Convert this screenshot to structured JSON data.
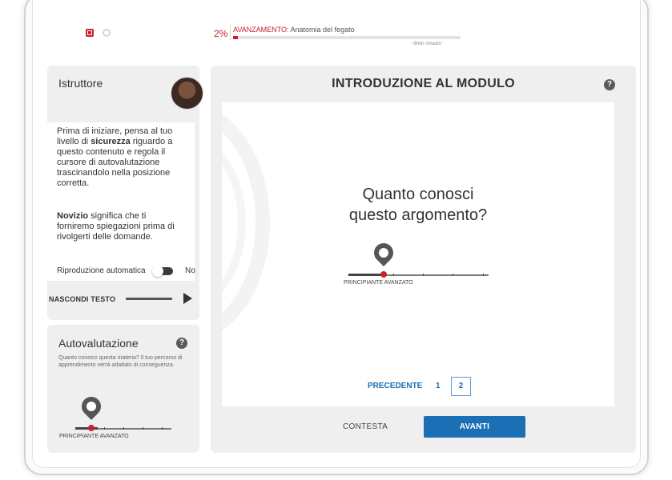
{
  "topbar": {
    "icons": [
      "module-icon",
      "settings-icon"
    ],
    "progress_percent_text": "2%",
    "progress_label": "AVANZAMENTO:",
    "progress_topic": "Anatomia del fegato",
    "progress_value": 0.02,
    "time_remaining": "~9min rimasto"
  },
  "instructor": {
    "title": "Istruttore",
    "paragraph1_a": "Prima di iniziare, pensa al tuo livello di ",
    "paragraph1_bold": "sicurezza",
    "paragraph1_b": " riguardo a questo contenuto e regola il cursore di autovalutazione trascinandolo nella posizione corretta.",
    "paragraph2_bold": "Novizio",
    "paragraph2_rest": " significa che ti forniremo spiegazioni prima di rivolgerti delle domande.",
    "autoplay_label": "Riproduzione automatica",
    "autoplay_value": "No",
    "hide_text_label": "NASCONDI TESTO"
  },
  "self_evaluation": {
    "title": "Autovalutazione",
    "description": "Quanto conosci questa materia? Il tuo percorso di apprendimento verrà adattato di conseguenza.",
    "slider_label": "PRINCIPIANTE AVANZATO"
  },
  "main": {
    "title": "INTRODUZIONE AL MODULO",
    "question_line1": "Quanto conosci",
    "question_line2": "questo argomento?",
    "slider_label": "PRINCIPIANTE AVANZATO",
    "pager": {
      "prev_label": "PRECEDENTE",
      "page1": "1",
      "page2": "2"
    },
    "contest_label": "CONTESTA",
    "next_label": "AVANTI"
  },
  "colors": {
    "accent_red": "#c8202f",
    "primary_blue": "#1a6fb5",
    "panel_gray": "#efefef"
  }
}
